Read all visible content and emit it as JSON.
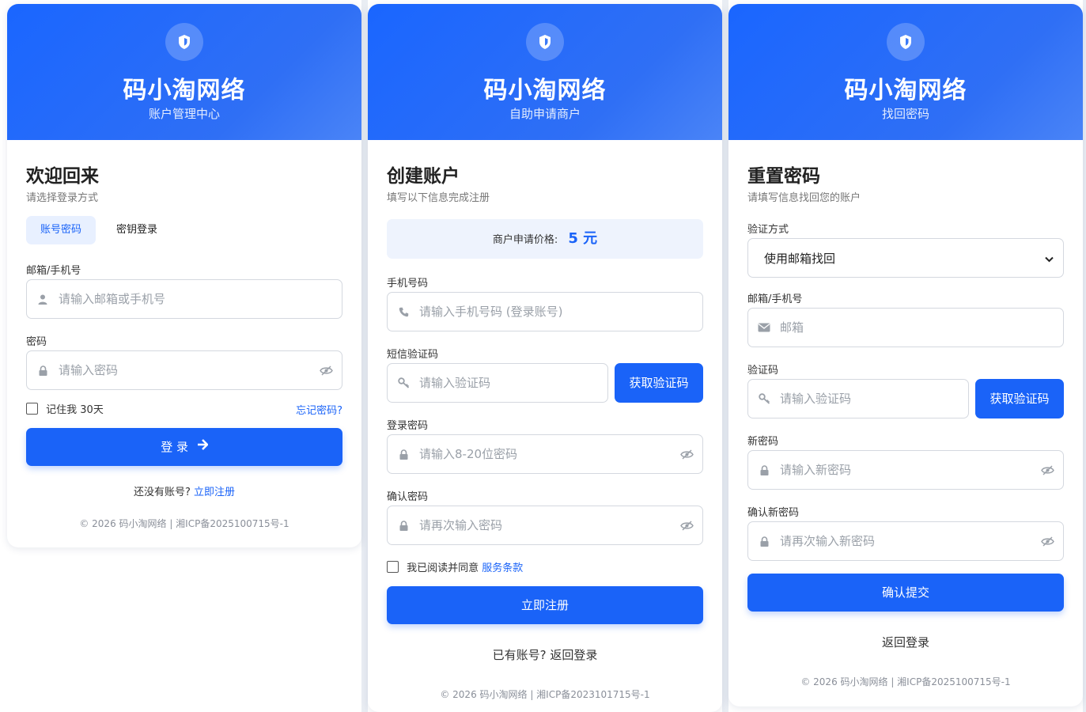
{
  "brand": "码小淘网络",
  "login": {
    "header_sub": "账户管理中心",
    "title": "欢迎回来",
    "subtitle": "请选择登录方式",
    "tab_password": "账号密码",
    "tab_key": "密钥登录",
    "account_label": "邮箱/手机号",
    "account_placeholder": "请输入邮箱或手机号",
    "password_label": "密码",
    "password_placeholder": "请输入密码",
    "remember": "记住我 30天",
    "forgot": "忘记密码?",
    "submit": "登 录",
    "no_account": "还没有账号?",
    "register_link": "立即注册",
    "footer": "© 2026 码小淘网络 | 湘ICP备2025100715号-1"
  },
  "register": {
    "header_sub": "自助申请商户",
    "title": "创建账户",
    "subtitle": "填写以下信息完成注册",
    "price_label": "商户申请价格:",
    "price_value": "5 元",
    "phone_label": "手机号码",
    "phone_placeholder": "请输入手机号码 (登录账号)",
    "sms_label": "短信验证码",
    "sms_placeholder": "请输入验证码",
    "get_code": "获取验证码",
    "password_label": "登录密码",
    "password_placeholder": "请输入8-20位密码",
    "confirm_label": "确认密码",
    "confirm_placeholder": "请再次输入密码",
    "agree_text": "我已阅读并同意",
    "terms_link": "服务条款",
    "submit": "立即注册",
    "has_account": "已有账号? 返回登录",
    "footer": "© 2026 码小淘网络 | 湘ICP备2023101715号-1"
  },
  "reset": {
    "header_sub": "找回密码",
    "title": "重置密码",
    "subtitle": "请填写信息找回您的账户",
    "method_label": "验证方式",
    "method_selected": "使用邮箱找回",
    "account_label": "邮箱/手机号",
    "account_placeholder": "邮箱",
    "code_label": "验证码",
    "code_placeholder": "请输入验证码",
    "get_code": "获取验证码",
    "new_label": "新密码",
    "new_placeholder": "请输入新密码",
    "confirm_label": "确认新密码",
    "confirm_placeholder": "请再次输入新密码",
    "submit": "确认提交",
    "back": "返回登录",
    "footer": "© 2026 码小淘网络 | 湘ICP备2025100715号-1"
  }
}
